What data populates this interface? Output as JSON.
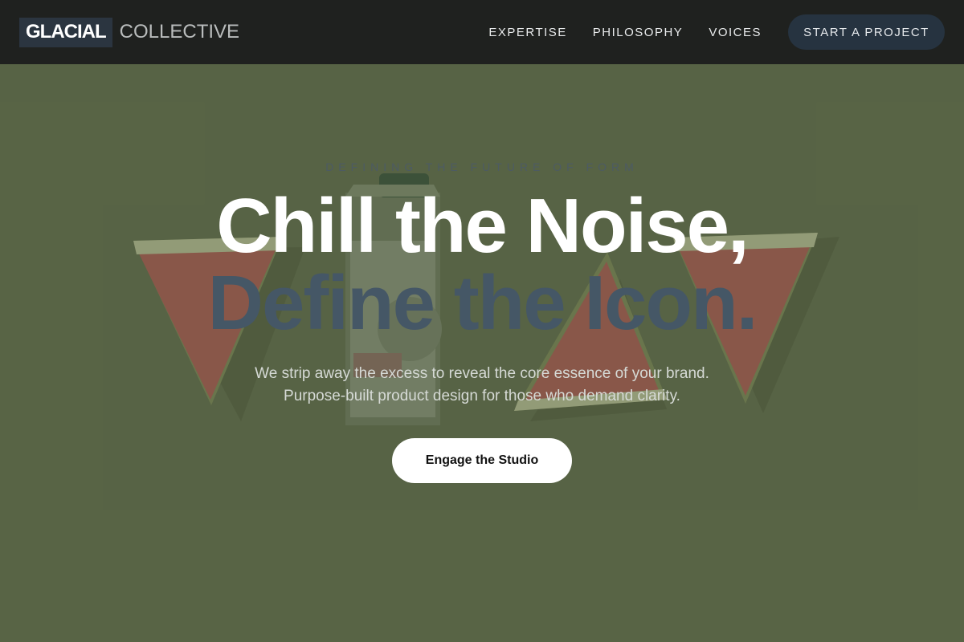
{
  "brand": {
    "name_box": "GLACIAL",
    "name_rest": "COLLECTIVE"
  },
  "nav": {
    "links": [
      "EXPERTISE",
      "PHILOSOPHY",
      "VOICES"
    ],
    "cta": "START A PROJECT"
  },
  "hero": {
    "eyebrow": "DEFINING THE FUTURE OF FORM",
    "headline_line1": "Chill the Noise,",
    "headline_line2": "Define the Icon.",
    "subtext_line1": "We strip away the excess to reveal the core essence of your brand.",
    "subtext_line2": "Purpose-built product design for those who demand clarity.",
    "cta": "Engage the Studio"
  },
  "colors": {
    "nav_bg": "#1f211f",
    "hero_bg": "#5d6a4b",
    "accent_dark": "#263340",
    "headline_secondary": "#455766"
  }
}
